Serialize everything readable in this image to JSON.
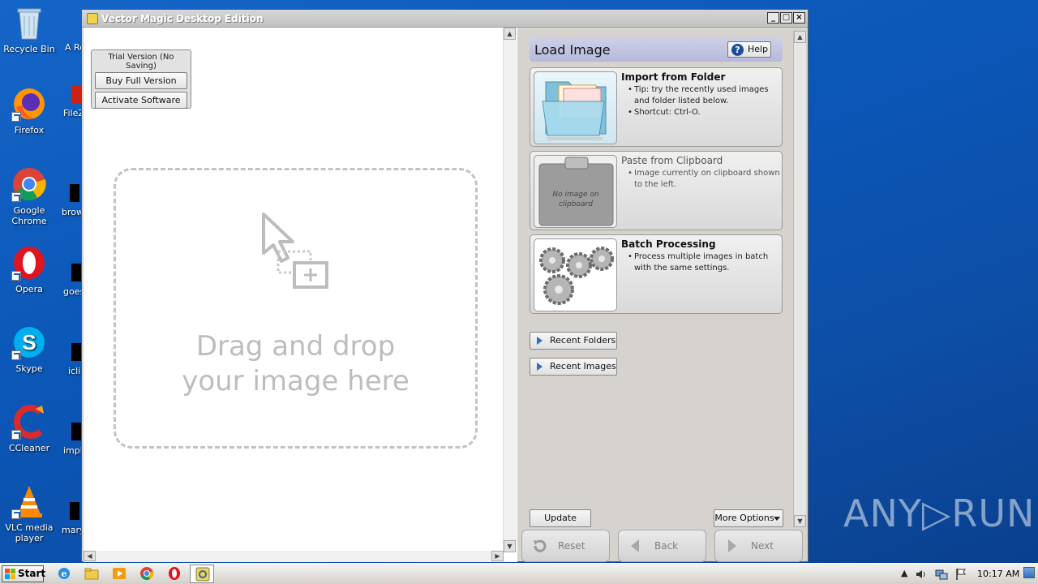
{
  "desktop": {
    "icons": [
      {
        "label": "Recycle Bin",
        "icon": "recycle-bin-icon"
      },
      {
        "label": "Firefox",
        "icon": "firefox-icon"
      },
      {
        "label": "Google Chrome",
        "icon": "chrome-icon"
      },
      {
        "label": "Opera",
        "icon": "opera-icon"
      },
      {
        "label": "Skype",
        "icon": "skype-icon"
      },
      {
        "label": "CCleaner",
        "icon": "ccleaner-icon"
      },
      {
        "label": "VLC media player",
        "icon": "vlc-icon"
      }
    ],
    "partial_icons": [
      "A\nRe",
      "FileZ",
      "brow",
      "goes",
      "iclie",
      "imple",
      "mary"
    ]
  },
  "window": {
    "title": "Vector Magic Desktop Edition",
    "controls": {
      "minimize": "_",
      "maximize": "□",
      "close": "×"
    }
  },
  "trial": {
    "label": "Trial Version (No Saving)",
    "buy_label": "Buy Full Version",
    "activate_label": "Activate Software"
  },
  "dropzone": {
    "line1": "Drag and drop",
    "line2": "your image here"
  },
  "panel": {
    "title": "Load Image",
    "help_label": "Help",
    "cards": [
      {
        "title": "Import from Folder",
        "bullets": [
          "Tip: try the recently used images and folder listed below.",
          "Shortcut: Ctrl-O."
        ],
        "enabled": true
      },
      {
        "title": "Paste from Clipboard",
        "bullets": [
          "Image currently on clipboard shown to the left."
        ],
        "thumb_text": "No image on clipboard",
        "enabled": false
      },
      {
        "title": "Batch Processing",
        "bullets": [
          "Process multiple images in batch with the same settings."
        ],
        "enabled": true
      }
    ],
    "recent_folders_label": "Recent Folders",
    "recent_images_label": "Recent Images",
    "update_label": "Update",
    "more_options_label": "More Options"
  },
  "nav": {
    "reset_label": "Reset",
    "back_label": "Back",
    "next_label": "Next"
  },
  "taskbar": {
    "start_label": "Start",
    "clock": "10:17 AM"
  },
  "watermark": "ANY▷RUN"
}
